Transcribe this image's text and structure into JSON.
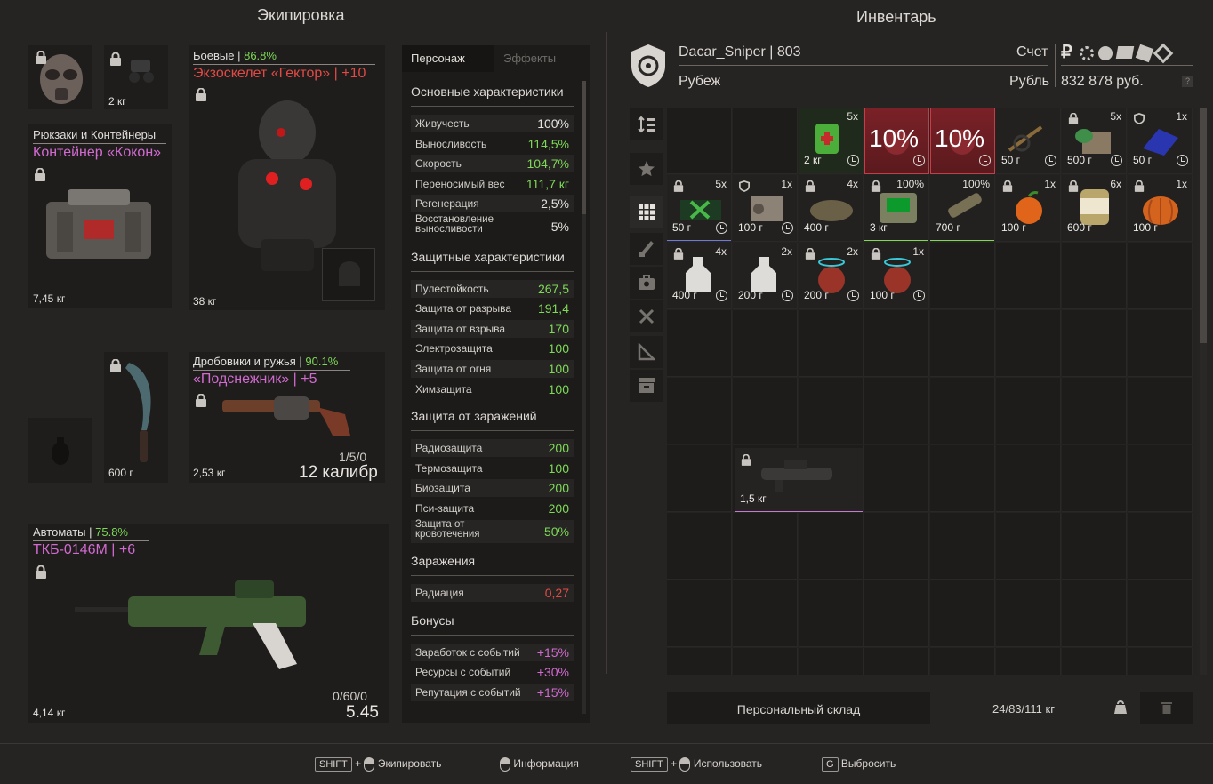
{
  "equipment": {
    "title": "Экипировка",
    "mask": {},
    "device": {
      "weight": "2 кг"
    },
    "backpack": {
      "category": "Рюкзаки и Контейнеры",
      "name": "Контейнер «Кокон»",
      "weight": "7,45 кг"
    },
    "armor": {
      "category": "Боевые",
      "durability": "86.8%",
      "name": "Экзоскелет «Гектор» | +10",
      "weight": "38 кг"
    },
    "knife": {
      "weight": "600 г"
    },
    "shotgun": {
      "category": "Дробовики и ружья",
      "durability": "90.1%",
      "name": "«Подснежник» | +5",
      "weight": "2,53 кг",
      "ammo": "1/5/0",
      "caliber": "12 калибр"
    },
    "rifle": {
      "category": "Автоматы",
      "durability": "75.8%",
      "name": "ТКБ-0146М | +6",
      "weight": "4,14 кг",
      "ammo": "0/60/0",
      "caliber": "5.45"
    }
  },
  "stats": {
    "tabs": [
      "Персонаж",
      "Эффекты"
    ],
    "sections": [
      {
        "title": "Основные характеристики",
        "rows": [
          {
            "label": "Живучесть",
            "value": "100%",
            "color": "#e6e2de"
          },
          {
            "label": "Выносливость",
            "value": "114,5%",
            "color": "#7ed957"
          },
          {
            "label": "Скорость",
            "value": "104,7%",
            "color": "#7ed957"
          },
          {
            "label": "Переносимый вес",
            "value": "111,7 кг",
            "color": "#7ed957"
          },
          {
            "label": "Регенерация",
            "value": "2,5%",
            "color": "#e6e2de"
          },
          {
            "label": "Восстановление выносливости",
            "value": "5%",
            "color": "#e6e2de",
            "tall": true
          }
        ]
      },
      {
        "title": "Защитные характеристики",
        "rows": [
          {
            "label": "Пулестойкость",
            "value": "267,5",
            "color": "#7ed957"
          },
          {
            "label": "Защита от разрыва",
            "value": "191,4",
            "color": "#7ed957"
          },
          {
            "label": "Защита от взрыва",
            "value": "170",
            "color": "#7ed957"
          },
          {
            "label": "Электрозащита",
            "value": "100",
            "color": "#7ed957"
          },
          {
            "label": "Защита от огня",
            "value": "100",
            "color": "#7ed957"
          },
          {
            "label": "Химзащита",
            "value": "100",
            "color": "#7ed957"
          }
        ]
      },
      {
        "title": "Защита от заражений",
        "rows": [
          {
            "label": "Радиозащита",
            "value": "200",
            "color": "#7ed957"
          },
          {
            "label": "Термозащита",
            "value": "100",
            "color": "#7ed957"
          },
          {
            "label": "Биозащита",
            "value": "200",
            "color": "#7ed957"
          },
          {
            "label": "Пси-защита",
            "value": "200",
            "color": "#7ed957"
          },
          {
            "label": "Защита от кровотечения",
            "value": "50%",
            "color": "#7ed957",
            "tall": true
          }
        ]
      },
      {
        "title": "Заражения",
        "rows": [
          {
            "label": "Радиация",
            "value": "0,27",
            "color": "#e04a45"
          }
        ]
      },
      {
        "title": "Бонусы",
        "rows": [
          {
            "label": "Заработок с событий",
            "value": "+15%",
            "color": "#d26ad0"
          },
          {
            "label": "Ресурсы с событий",
            "value": "+30%",
            "color": "#d26ad0"
          },
          {
            "label": "Репутация с событий",
            "value": "+15%",
            "color": "#d26ad0"
          }
        ]
      }
    ]
  },
  "inventory": {
    "title": "Инвентарь",
    "player": "Dacar_Sniper | 803",
    "location": "Рубеж",
    "account_label": "Счет",
    "currency_symbol": "₽",
    "currency_label": "Рубль",
    "balance": "832 878 руб.",
    "help": "?",
    "storage_label": "Персональный склад",
    "capacity": "24/83/111 кг",
    "items": [
      {
        "col": 2,
        "row": 0,
        "count": "5x",
        "weight": "2 кг",
        "clock": true,
        "lock": false,
        "shield": false,
        "icon": "medkit-icon",
        "bg": "#1f2a1c"
      },
      {
        "col": 3,
        "row": 0,
        "count": "",
        "weight": "",
        "clock": true,
        "pct": "10%",
        "icon": "booster-icon",
        "bg": "#6b1e22",
        "red": true
      },
      {
        "col": 4,
        "row": 0,
        "count": "",
        "weight": "",
        "clock": true,
        "pct": "10%",
        "icon": "booster-icon",
        "bg": "#6b1e22",
        "red": true
      },
      {
        "col": 5,
        "row": 0,
        "count": "",
        "weight": "50 г",
        "clock": true,
        "icon": "fishing-tool-icon",
        "bg": "#22211f"
      },
      {
        "col": 6,
        "row": 0,
        "count": "5x",
        "weight": "500 г",
        "clock": true,
        "lock": true,
        "icon": "package-icon",
        "bg": "#22211f"
      },
      {
        "col": 7,
        "row": 0,
        "count": "1x",
        "weight": "50 г",
        "clock": true,
        "shield": true,
        "icon": "cloth-icon",
        "bg": "#22211f"
      },
      {
        "col": 0,
        "row": 1,
        "count": "5x",
        "weight": "50 г",
        "clock": true,
        "lock": true,
        "icon": "green-box-icon",
        "bg": "#22211f",
        "line": "#6f7ad8"
      },
      {
        "col": 1,
        "row": 1,
        "count": "1x",
        "weight": "100 г",
        "clock": true,
        "shield": true,
        "icon": "crate-icon",
        "bg": "#22211f"
      },
      {
        "col": 2,
        "row": 1,
        "count": "4x",
        "weight": "400 г",
        "clock": false,
        "lock": true,
        "icon": "bread-icon",
        "bg": "#22211f"
      },
      {
        "col": 3,
        "row": 1,
        "count": "100%",
        "weight": "3 кг",
        "clock": false,
        "lock": true,
        "icon": "detector-icon",
        "bg": "#22211f",
        "line": "#7ed957"
      },
      {
        "col": 4,
        "row": 1,
        "count": "100%",
        "weight": "700 г",
        "clock": false,
        "icon": "flashlight-icon",
        "bg": "#22211f",
        "line": "#7ed957"
      },
      {
        "col": 5,
        "row": 1,
        "count": "1x",
        "weight": "100 г",
        "clock": false,
        "lock": true,
        "icon": "tangerine-icon",
        "bg": "#22211f"
      },
      {
        "col": 6,
        "row": 1,
        "count": "6x",
        "weight": "600 г",
        "clock": false,
        "lock": true,
        "icon": "can-icon",
        "bg": "#22211f"
      },
      {
        "col": 7,
        "row": 1,
        "count": "1x",
        "weight": "100 г",
        "clock": false,
        "lock": true,
        "icon": "pumpkin-icon",
        "bg": "#22211f"
      },
      {
        "col": 0,
        "row": 2,
        "count": "4x",
        "weight": "400 г",
        "clock": true,
        "lock": true,
        "icon": "bottle-icon",
        "bg": "#22211f"
      },
      {
        "col": 1,
        "row": 2,
        "count": "2x",
        "weight": "200 г",
        "clock": true,
        "icon": "bottle-icon",
        "bg": "#22211f"
      },
      {
        "col": 2,
        "row": 2,
        "count": "2x",
        "weight": "200 г",
        "clock": true,
        "lock": true,
        "icon": "artifact-icon",
        "bg": "#22211f"
      },
      {
        "col": 3,
        "row": 2,
        "count": "1x",
        "weight": "100 г",
        "clock": true,
        "lock": true,
        "icon": "artifact-icon",
        "bg": "#22211f"
      }
    ],
    "launcher": {
      "weight": "1,5 кг"
    }
  },
  "footer": [
    {
      "key": "SHIFT",
      "mouse": true,
      "label": "Экипировать"
    },
    {
      "key": "",
      "mouse": true,
      "label": "Информация"
    },
    {
      "key": "SHIFT",
      "mouse": true,
      "label": "Использовать"
    },
    {
      "key": "G",
      "mouse": false,
      "label": "Выбросить"
    }
  ]
}
